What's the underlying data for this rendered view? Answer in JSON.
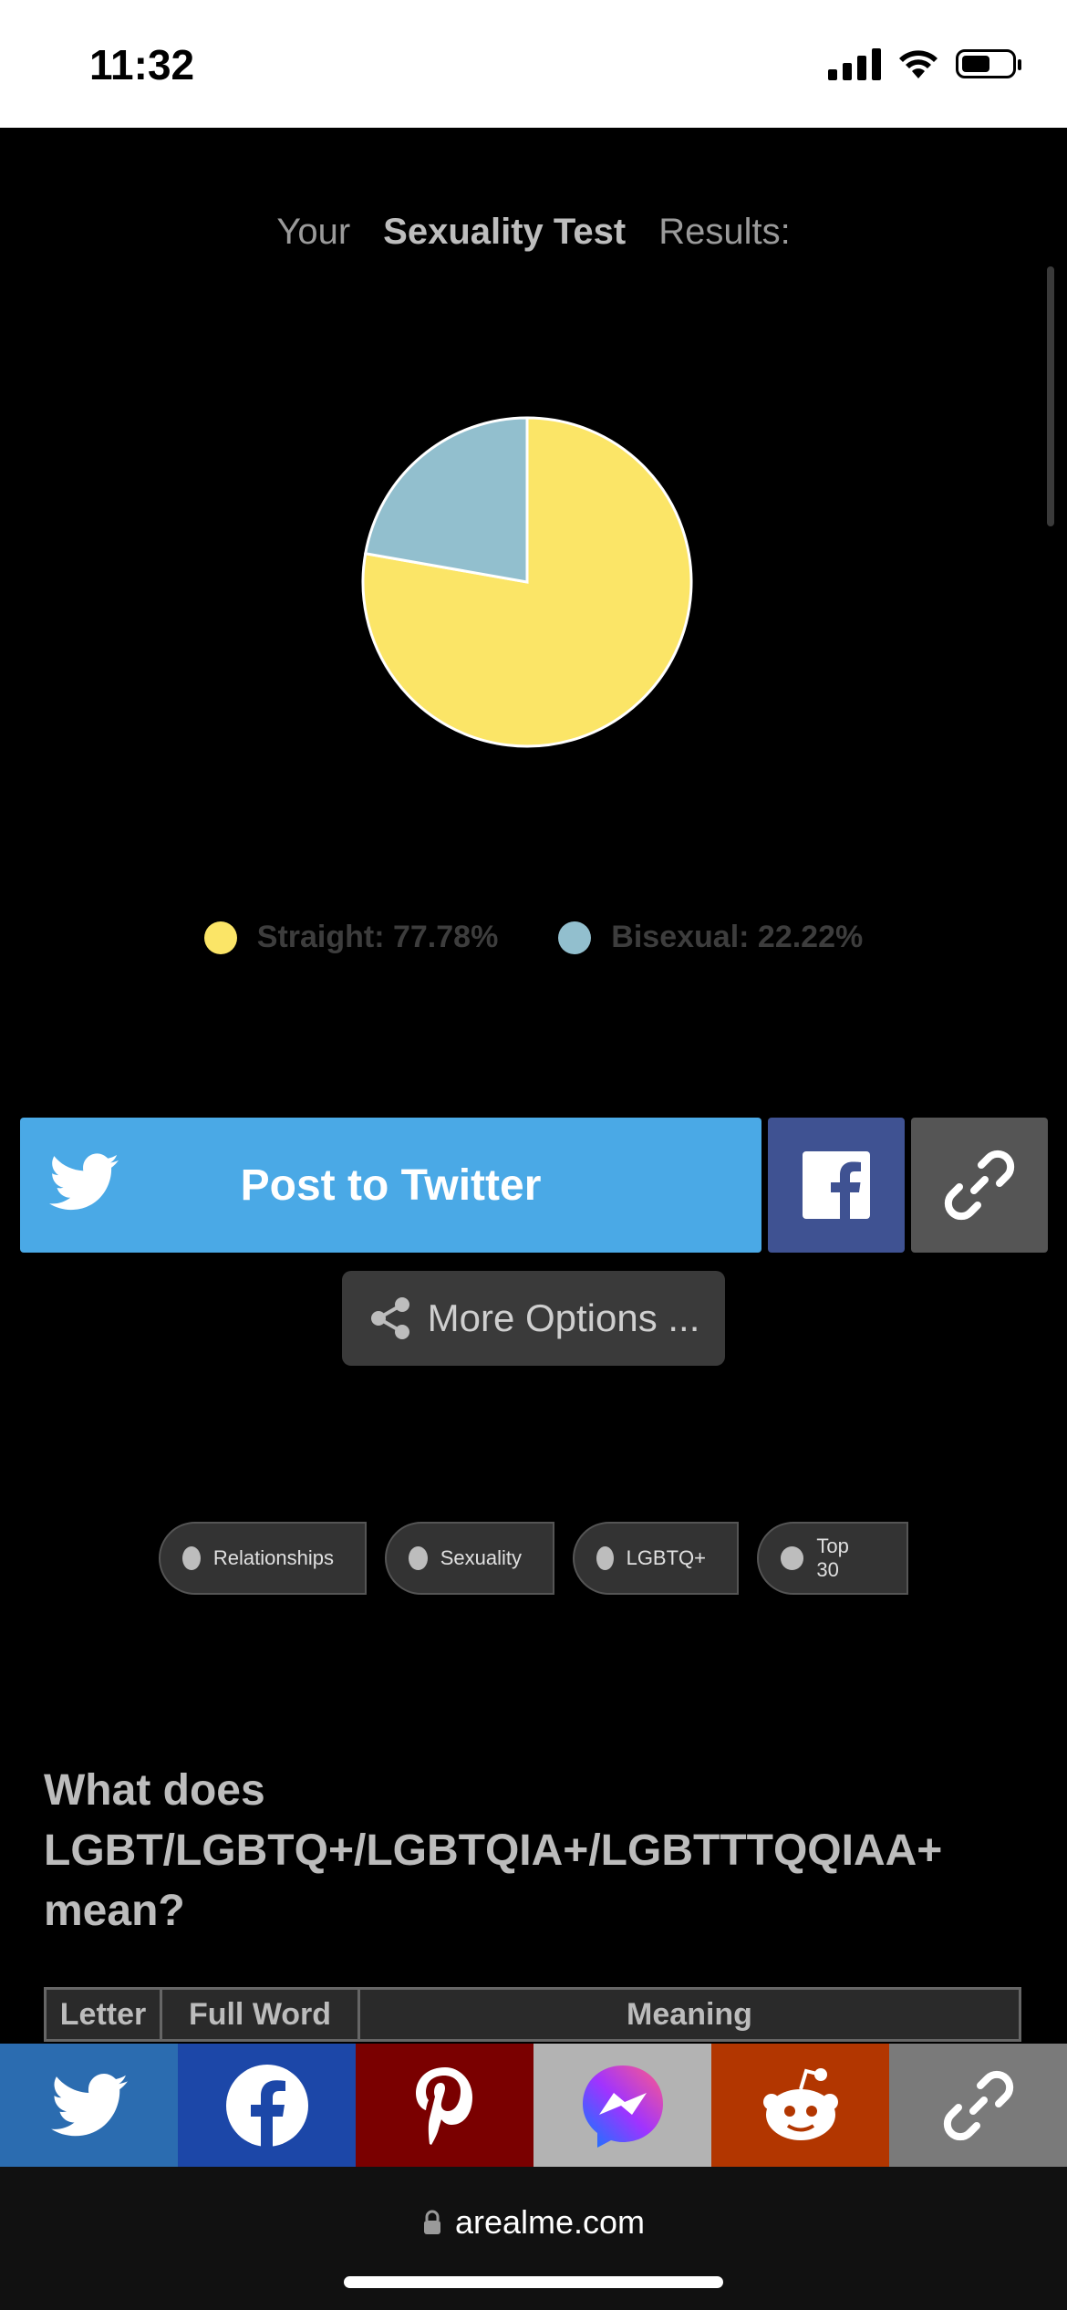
{
  "status_bar": {
    "time": "11:32"
  },
  "title": {
    "prefix": "Your",
    "main": "Sexuality Test",
    "suffix": "Results:"
  },
  "chart_data": {
    "type": "pie",
    "title": "",
    "series": [
      {
        "name": "Straight",
        "value": 77.78,
        "color": "#fbe567"
      },
      {
        "name": "Bisexual",
        "value": 22.22,
        "color": "#92bfce"
      }
    ]
  },
  "legend": [
    {
      "label": "Straight: 77.78%",
      "color": "#fbe567"
    },
    {
      "label": "Bisexual: 22.22%",
      "color": "#92bfce"
    }
  ],
  "share": {
    "twitter_label": "Post to Twitter",
    "more_options_label": "More Options ...",
    "colors": {
      "twitter": "#4aa9e6",
      "facebook": "#3f5292",
      "link": "#555555"
    }
  },
  "tags": [
    "Relationships",
    "Sexuality",
    "LGBTQ+",
    "Top 30"
  ],
  "faq": {
    "heading": "What does LGBT/LGBTQ+/LGBTQIA+/LGBTTTQQIAA+ mean?",
    "table_headers": [
      "Letter",
      "Full Word",
      "Meaning"
    ]
  },
  "share_bar": [
    {
      "icon": "twitter-icon",
      "color": "#2b6cb0"
    },
    {
      "icon": "facebook-icon",
      "color": "#1c47a8"
    },
    {
      "icon": "pinterest-icon",
      "color": "#7a0000"
    },
    {
      "icon": "messenger-icon",
      "color": "#b3b3b3"
    },
    {
      "icon": "reddit-icon",
      "color": "#b23600"
    },
    {
      "icon": "link-icon",
      "color": "#7a7a7a"
    }
  ],
  "browser": {
    "url": "arealme.com"
  }
}
